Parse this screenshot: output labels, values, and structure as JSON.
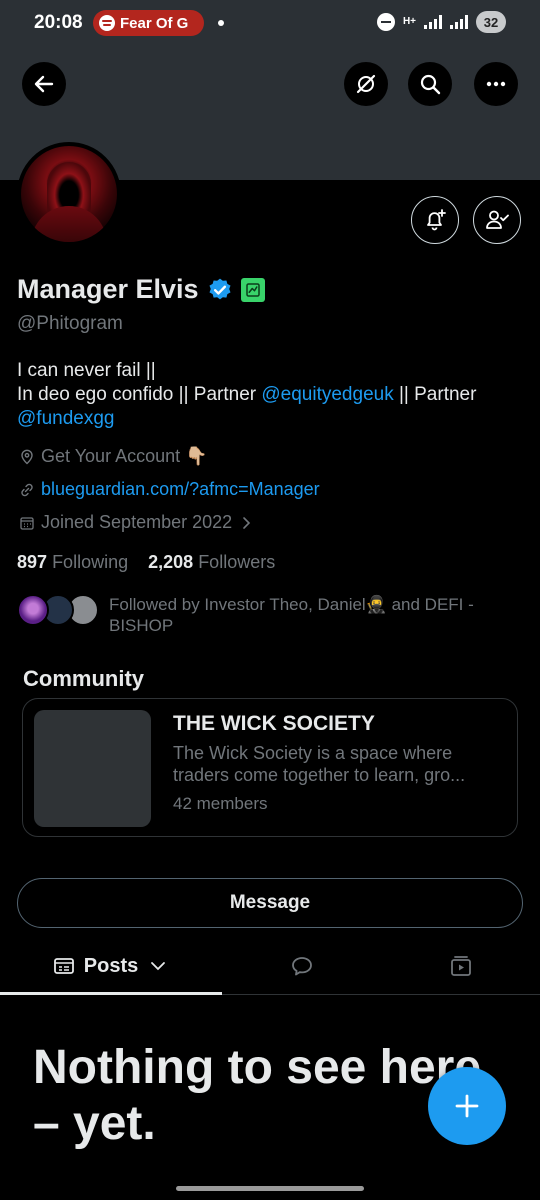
{
  "status_bar": {
    "time": "20:08",
    "media_pill": "Fear Of G",
    "network": "H+",
    "battery": "32"
  },
  "profile": {
    "name": "Manager Elvis",
    "handle": "@Phitogram",
    "bio_line1": "I can never fail ||",
    "bio_line2_prefix": "In deo ego confido || Partner ",
    "bio_mention1": "@equityedgeuk",
    "bio_line2_suffix": " || Partner",
    "bio_mention2": "@fundexgg",
    "location": "Get Your Account 👇🏼",
    "website": "blueguardian.com/?afmc=Manager",
    "joined": "Joined September 2022",
    "following_count": "897",
    "following_label": "Following",
    "followers_count": "2,208",
    "followers_label": "Followers",
    "followed_by": "Followed by Investor Theo, Daniel🥷 and DEFI - BISHOP"
  },
  "community": {
    "section_title": "Community",
    "name": "THE WICK SOCIETY",
    "desc_line1": "The Wick Society is a space where",
    "desc_line2": "traders come together to learn, gro...",
    "members": "42 members"
  },
  "actions": {
    "message": "Message"
  },
  "tabs": {
    "posts": "Posts"
  },
  "empty_state": {
    "title": "Nothing to see here – yet."
  },
  "colors": {
    "accent": "#1d9bf0",
    "background": "#000000",
    "banner": "#2b3035",
    "muted_text": "#71767b",
    "affiliate_green": "#39d36a",
    "spotify_pill": "#b3261e"
  }
}
